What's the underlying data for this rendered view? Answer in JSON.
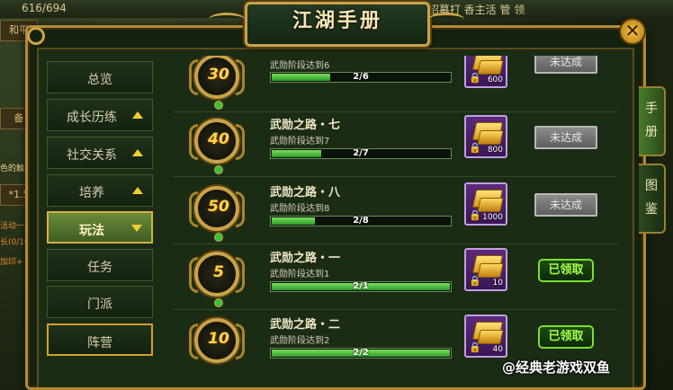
{
  "window": {
    "title": "江湖手册",
    "close_icon": "close-icon"
  },
  "sidebar": {
    "items": [
      {
        "label": "总览",
        "arrow": ""
      },
      {
        "label": "成长历练",
        "arrow": "up"
      },
      {
        "label": "社交关系",
        "arrow": "up"
      },
      {
        "label": "培养",
        "arrow": "up"
      },
      {
        "label": "玩法",
        "arrow": "down",
        "selected": true
      },
      {
        "label": "任务",
        "arrow": ""
      },
      {
        "label": "门派",
        "arrow": ""
      },
      {
        "label": "阵营",
        "arrow": "",
        "framed": true
      }
    ]
  },
  "side_tabs": [
    {
      "label_top": "手",
      "label_bottom": "册"
    },
    {
      "label_top": "图",
      "label_bottom": "鉴"
    }
  ],
  "achievements": [
    {
      "badge": "30",
      "title": "",
      "desc": "武勋阶段达到6",
      "progress_text": "2/6",
      "progress": 0.333,
      "reward_amount": "600",
      "status": "未达成"
    },
    {
      "badge": "40",
      "title": "武勋之路・七",
      "desc": "武勋阶段达到7",
      "progress_text": "2/7",
      "progress": 0.286,
      "reward_amount": "800",
      "status": "未达成"
    },
    {
      "badge": "50",
      "title": "武勋之路・八",
      "desc": "武勋阶段达到8",
      "progress_text": "2/8",
      "progress": 0.25,
      "reward_amount": "1000",
      "status": "未达成"
    },
    {
      "badge": "5",
      "title": "武勋之路・一",
      "desc": "武勋阶段达到1",
      "progress_text": "2/1",
      "progress": 1.0,
      "reward_amount": "10",
      "status": "已领取"
    },
    {
      "badge": "10",
      "title": "武勋之路・二",
      "desc": "武勋阶段达到2",
      "progress_text": "2/2",
      "progress": 1.0,
      "reward_amount": "40",
      "status": "已领取"
    }
  ],
  "background": {
    "top_text_left": "616/694",
    "top_text_right": "成 招募打 香主活 管 领",
    "left_chips": [
      "和平",
      "备",
      "*1.5"
    ],
    "left_snippets": [
      "色的触角",
      "活动一次",
      "长(0/10",
      "加印+"
    ]
  },
  "watermark": "@经典老游戏双鱼",
  "colors": {
    "accent_gold": "#c9a24a",
    "progress_green": "#3cb83c",
    "claimed_green": "#a6ff48"
  }
}
